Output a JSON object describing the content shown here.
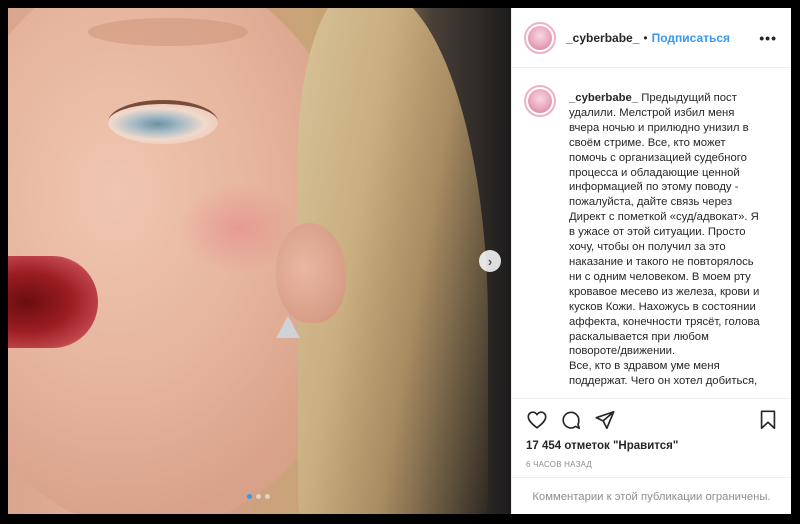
{
  "post": {
    "username": "_cyberbabe_",
    "separator": "•",
    "follow_label": "Подписаться",
    "more_label": "•••",
    "caption_username": "_cyberbabe_",
    "caption_lines": [
      "Предыдущий пост",
      "удалили. Мелстрой избил меня",
      "вчера ночью и прилюдно унизил в",
      "своём стриме. Все, кто может",
      "помочь с организацией судебного",
      "процесса и обладающие ценной",
      "информацией по этому поводу -",
      "пожалуйста, дайте связь через",
      "Директ с пометкой «суд/адвокат». Я",
      "в ужасе от этой ситуации. Просто",
      "хочу, чтобы он получил за это",
      "наказание и такого не повторялось",
      "ни с одним человеком. В моем рту",
      "кровавое месево из железа, крови и",
      "кусков Кожи. Нахожусь в состоянии",
      "аффекта, конечности трясёт, голова",
      "раскалывается при любом",
      "повороте/движении.",
      "Все, кто в здравом уме меня",
      "поддержат. Чего он хотел добиться,"
    ],
    "likes": "17 454 отметок \"Нравится\"",
    "time": "6 ЧАСОВ НАЗАД",
    "comments_disabled": "Комментарии к этой публикации ограничены."
  },
  "carousel": {
    "next_label": "›",
    "count": 3,
    "active_index": 0
  },
  "icons": {
    "like": "heart-icon",
    "comment": "comment-icon",
    "share": "paper-plane-icon",
    "save": "bookmark-icon"
  },
  "colors": {
    "follow": "#3897f0",
    "muted": "#8e8e8e",
    "text": "#262626"
  }
}
